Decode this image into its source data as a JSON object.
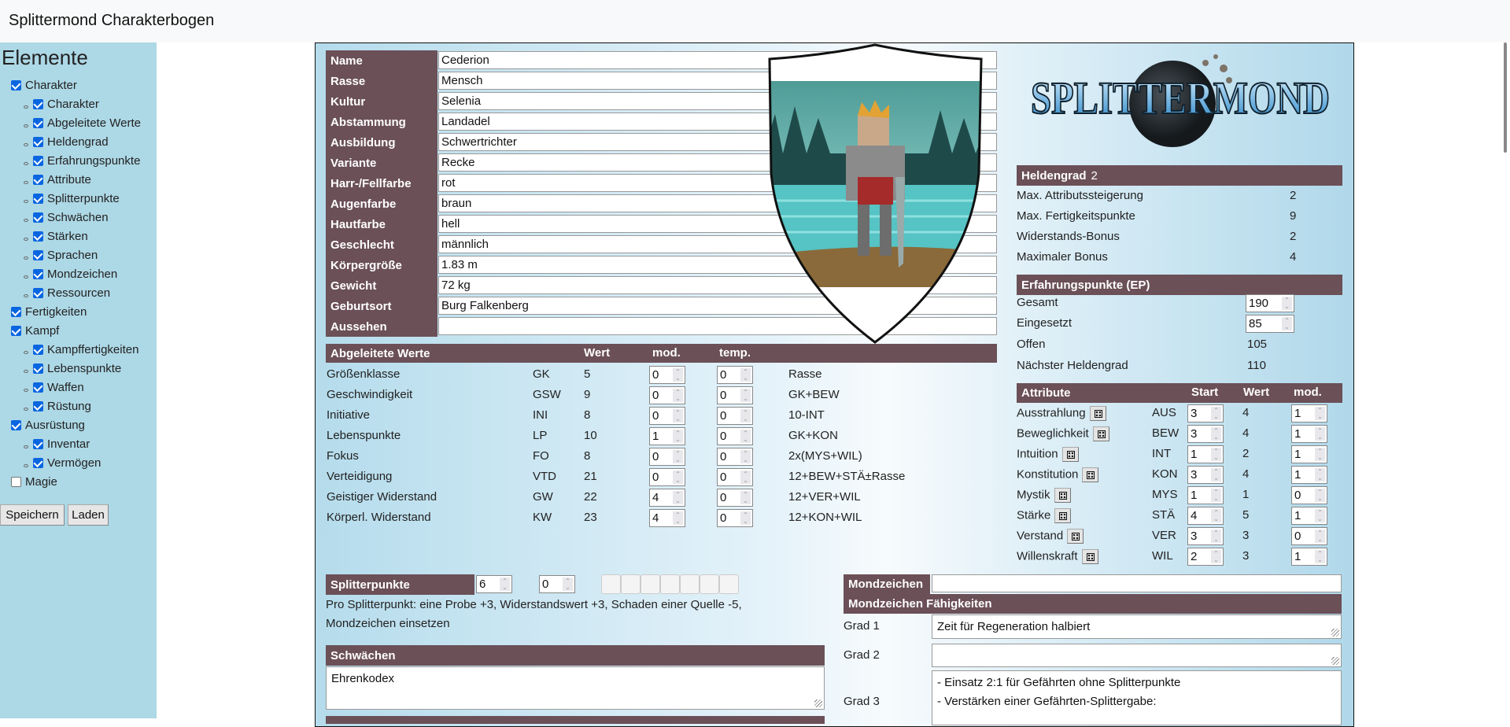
{
  "app": {
    "title": "Splittermond Charakterbogen"
  },
  "sidebar": {
    "title": "Elemente",
    "items": [
      {
        "label": "Charakter",
        "level": 0,
        "checked": true
      },
      {
        "label": "Charakter",
        "level": 1,
        "checked": true
      },
      {
        "label": "Abgeleitete Werte",
        "level": 1,
        "checked": true
      },
      {
        "label": "Heldengrad",
        "level": 1,
        "checked": true
      },
      {
        "label": "Erfahrungspunkte",
        "level": 1,
        "checked": true
      },
      {
        "label": "Attribute",
        "level": 1,
        "checked": true
      },
      {
        "label": "Splitterpunkte",
        "level": 1,
        "checked": true
      },
      {
        "label": "Schwächen",
        "level": 1,
        "checked": true
      },
      {
        "label": "Stärken",
        "level": 1,
        "checked": true
      },
      {
        "label": "Sprachen",
        "level": 1,
        "checked": true
      },
      {
        "label": "Mondzeichen",
        "level": 1,
        "checked": true
      },
      {
        "label": "Ressourcen",
        "level": 1,
        "checked": true
      },
      {
        "label": "Fertigkeiten",
        "level": 0,
        "checked": true
      },
      {
        "label": "Kampf",
        "level": 0,
        "checked": true
      },
      {
        "label": "Kampffertigkeiten",
        "level": 1,
        "checked": true
      },
      {
        "label": "Lebenspunkte",
        "level": 1,
        "checked": true
      },
      {
        "label": "Waffen",
        "level": 1,
        "checked": true
      },
      {
        "label": "Rüstung",
        "level": 1,
        "checked": true
      },
      {
        "label": "Ausrüstung",
        "level": 0,
        "checked": true
      },
      {
        "label": "Inventar",
        "level": 1,
        "checked": true
      },
      {
        "label": "Vermögen",
        "level": 1,
        "checked": true
      },
      {
        "label": "Magie",
        "level": 0,
        "checked": false
      }
    ],
    "save_label": "Speichern",
    "load_label": "Laden"
  },
  "character": {
    "fields": [
      {
        "label": "Name",
        "value": "Cederion"
      },
      {
        "label": "Rasse",
        "value": "Mensch"
      },
      {
        "label": "Kultur",
        "value": "Selenia"
      },
      {
        "label": "Abstammung",
        "value": "Landadel"
      },
      {
        "label": "Ausbildung",
        "value": "Schwertrichter"
      },
      {
        "label": "Variante",
        "value": "Recke"
      },
      {
        "label": "Harr-/Fellfarbe",
        "value": "rot"
      },
      {
        "label": "Augenfarbe",
        "value": "braun"
      },
      {
        "label": "Hautfarbe",
        "value": "hell"
      },
      {
        "label": "Geschlecht",
        "value": "männlich"
      },
      {
        "label": "Körpergröße",
        "value": "1.83 m"
      },
      {
        "label": "Gewicht",
        "value": "72 kg"
      },
      {
        "label": "Geburtsort",
        "value": "Burg Falkenberg"
      },
      {
        "label": "Aussehen",
        "value": ""
      }
    ]
  },
  "logo": {
    "text": "SPLITTERMOND"
  },
  "derived": {
    "title": "Abgeleitete Werte",
    "col_wert": "Wert",
    "col_mod": "mod.",
    "col_temp": "temp.",
    "rows": [
      {
        "name": "Größenklasse",
        "abbr": "GK",
        "wert": "5",
        "mod": "0",
        "temp": "0",
        "formula": "Rasse"
      },
      {
        "name": "Geschwindigkeit",
        "abbr": "GSW",
        "wert": "9",
        "mod": "0",
        "temp": "0",
        "formula": "GK+BEW"
      },
      {
        "name": "Initiative",
        "abbr": "INI",
        "wert": "8",
        "mod": "0",
        "temp": "0",
        "formula": "10-INT"
      },
      {
        "name": "Lebenspunkte",
        "abbr": "LP",
        "wert": "10",
        "mod": "1",
        "temp": "0",
        "formula": "GK+KON"
      },
      {
        "name": "Fokus",
        "abbr": "FO",
        "wert": "8",
        "mod": "0",
        "temp": "0",
        "formula": "2x(MYS+WIL)"
      },
      {
        "name": "Verteidigung",
        "abbr": "VTD",
        "wert": "21",
        "mod": "0",
        "temp": "0",
        "formula": "12+BEW+STÄ±Rasse"
      },
      {
        "name": "Geistiger Widerstand",
        "abbr": "GW",
        "wert": "22",
        "mod": "4",
        "temp": "0",
        "formula": "12+VER+WIL"
      },
      {
        "name": "Körperl. Widerstand",
        "abbr": "KW",
        "wert": "23",
        "mod": "4",
        "temp": "0",
        "formula": "12+KON+WIL"
      }
    ]
  },
  "heldengrad": {
    "title": "Heldengrad",
    "value": "2",
    "rows": [
      {
        "label": "Max. Attributssteigerung",
        "value": "2"
      },
      {
        "label": "Max. Fertigkeitspunkte",
        "value": "9"
      },
      {
        "label": "Widerstands-Bonus",
        "value": "2"
      },
      {
        "label": "Maximaler Bonus",
        "value": "4"
      }
    ]
  },
  "ep": {
    "title": "Erfahrungspunkte (EP)",
    "gesamt_label": "Gesamt",
    "gesamt": "190",
    "eingesetzt_label": "Eingesetzt",
    "eingesetzt": "85",
    "offen_label": "Offen",
    "offen": "105",
    "next_label": "Nächster Heldengrad",
    "next": "110"
  },
  "attributes": {
    "title": "Attribute",
    "col_start": "Start",
    "col_wert": "Wert",
    "col_mod": "mod.",
    "rows": [
      {
        "name": "Ausstrahlung",
        "abbr": "AUS",
        "start": "3",
        "wert": "4",
        "mod": "1"
      },
      {
        "name": "Beweglichkeit",
        "abbr": "BEW",
        "start": "3",
        "wert": "4",
        "mod": "1"
      },
      {
        "name": "Intuition",
        "abbr": "INT",
        "start": "1",
        "wert": "2",
        "mod": "1"
      },
      {
        "name": "Konstitution",
        "abbr": "KON",
        "start": "3",
        "wert": "4",
        "mod": "1"
      },
      {
        "name": "Mystik",
        "abbr": "MYS",
        "start": "1",
        "wert": "1",
        "mod": "0"
      },
      {
        "name": "Stärke",
        "abbr": "STÄ",
        "start": "4",
        "wert": "5",
        "mod": "1"
      },
      {
        "name": "Verstand",
        "abbr": "VER",
        "start": "3",
        "wert": "3",
        "mod": "0"
      },
      {
        "name": "Willenskraft",
        "abbr": "WIL",
        "start": "2",
        "wert": "3",
        "mod": "1"
      }
    ]
  },
  "splitter": {
    "title": "Splitterpunkte",
    "total": "6",
    "used": "0",
    "info_line1": "Pro Splitterpunkt: eine Probe +3, Widerstandswert +3, Schaden einer Quelle -5,",
    "info_line2": "Mondzeichen einsetzen"
  },
  "schwaechen": {
    "title": "Schwächen",
    "value": "Ehrenkodex"
  },
  "mondzeichen": {
    "label": "Mondzeichen",
    "value": "",
    "abilities_title": "Mondzeichen Fähigkeiten",
    "grades": [
      {
        "label": "Grad 1",
        "lines": [
          "Zeit für Regeneration halbiert"
        ]
      },
      {
        "label": "Grad 2",
        "lines": []
      },
      {
        "label": "Grad 3",
        "lines": [
          "- Einsatz 2:1 für Gefährten ohne Splitterpunkte",
          "- Verstärken einer Gefährten-Splittergabe:"
        ]
      }
    ]
  },
  "colors": {
    "header": "#6b5058",
    "sidebar": "#add8e6",
    "checkbox": "#0a66e0"
  }
}
